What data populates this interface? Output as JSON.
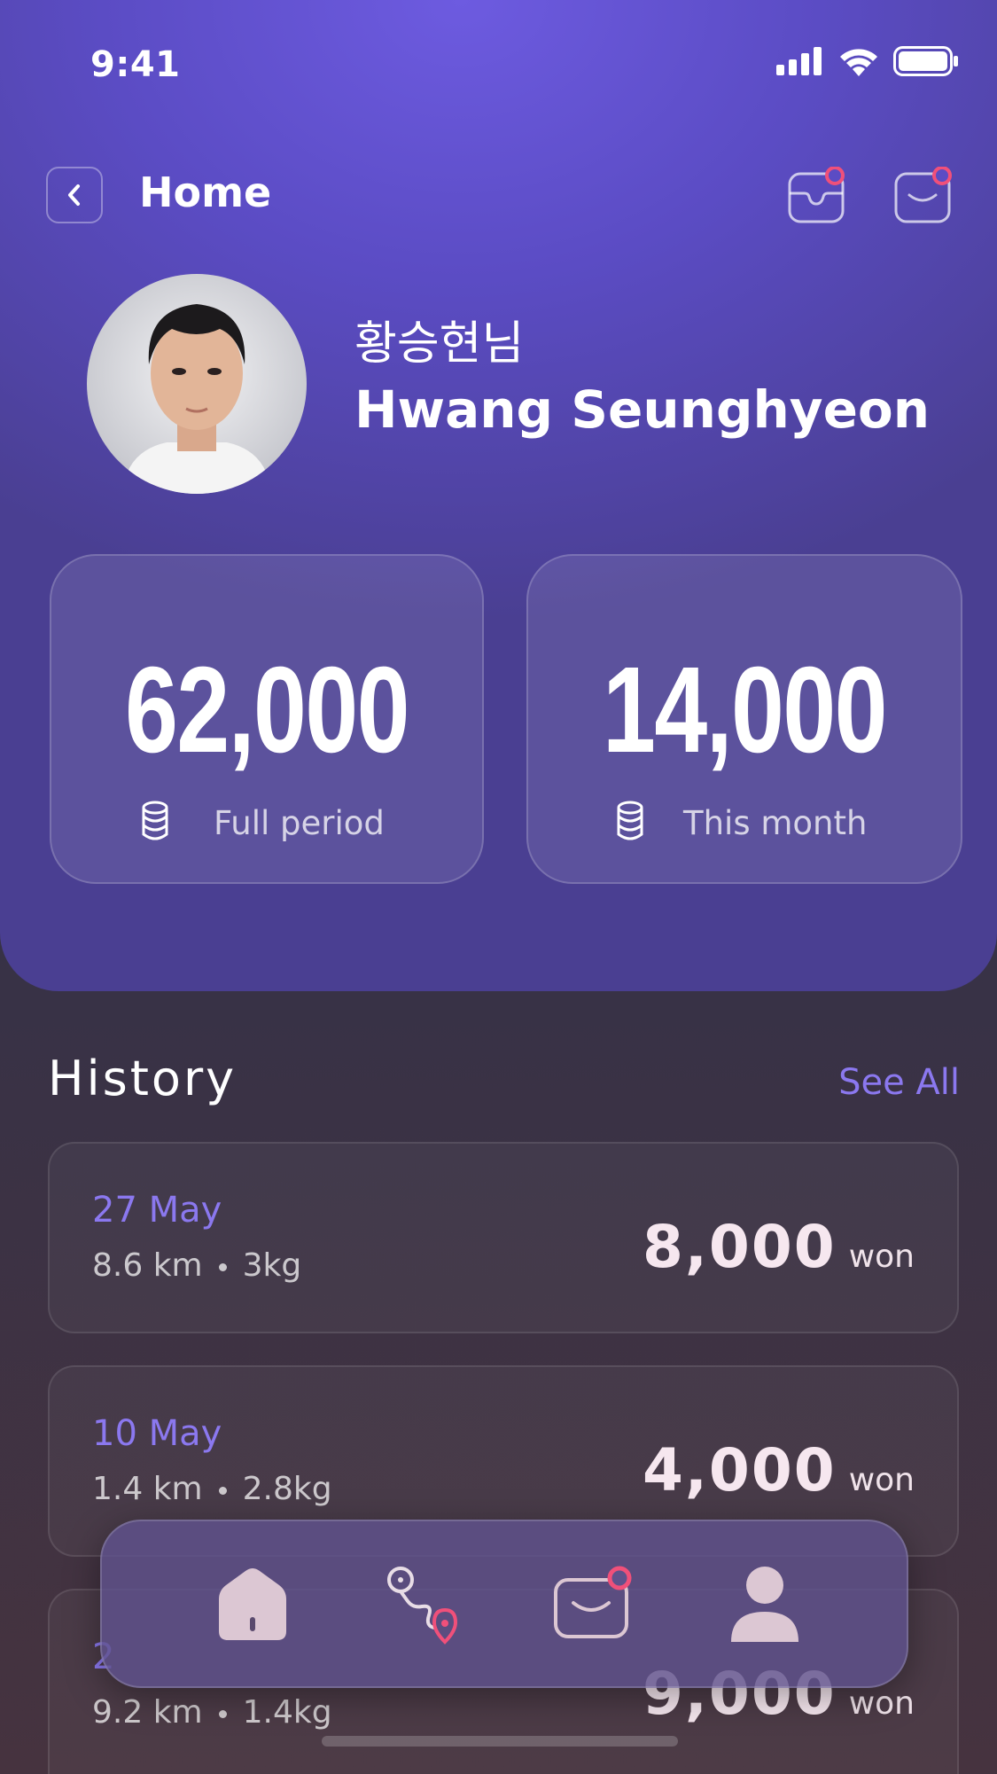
{
  "status": {
    "time": "9:41"
  },
  "header": {
    "title": "Home"
  },
  "profile": {
    "name_ko": "황승현님",
    "name_en": "Hwang Seunghyeon"
  },
  "stats": [
    {
      "value": "62,000",
      "label": "Full period"
    },
    {
      "value": "14,000",
      "label": "This month"
    }
  ],
  "history": {
    "title": "History",
    "see_all": "See All",
    "items": [
      {
        "date": "27 May",
        "distance": "8.6 km",
        "weight": "3kg",
        "amount": "8,000",
        "unit": "won"
      },
      {
        "date": "10 May",
        "distance": "1.4 km",
        "weight": "2.8kg",
        "amount": "4,000",
        "unit": "won"
      },
      {
        "date": "2",
        "distance": "9.2 km",
        "weight": "1.4kg",
        "amount": "9,000",
        "unit": "won"
      }
    ]
  },
  "nav": {
    "items": [
      {
        "icon": "home-icon",
        "active": true
      },
      {
        "icon": "route-icon",
        "active": false
      },
      {
        "icon": "mail-icon",
        "active": false
      },
      {
        "icon": "profile-icon",
        "active": false
      }
    ]
  },
  "colors": {
    "accent": "#8b78ef",
    "notification": "#f0507a",
    "header_bg": "#5b4cc4"
  }
}
